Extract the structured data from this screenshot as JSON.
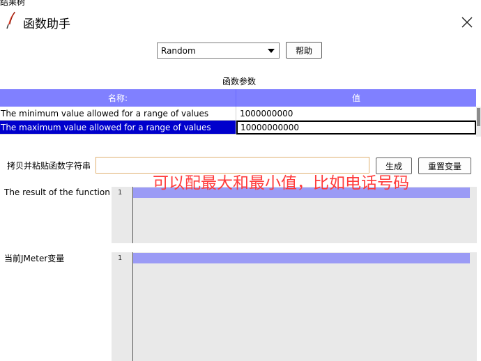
{
  "background_window": {
    "title": "结果树"
  },
  "window": {
    "title": "函数助手"
  },
  "function_select": {
    "selected": "Random"
  },
  "buttons": {
    "help": "帮助",
    "generate": "生成",
    "reset_variables": "重置变量"
  },
  "params": {
    "section_label": "函数参数",
    "columns": {
      "name": "名称:",
      "value": "值"
    },
    "rows": [
      {
        "name": "The minimum value allowed for a range of values",
        "value": "1000000000"
      },
      {
        "name": "The maximum value allowed for a range of values",
        "value": "10000000000"
      }
    ]
  },
  "copy_paste": {
    "label": "拷贝并粘贴函数字符串",
    "value": ""
  },
  "annotation": "可以配最大和最小值，比如电话号码",
  "result": {
    "label": "The result of the function is",
    "line_number": "1"
  },
  "jmeter_vars": {
    "label": "当前JMeter变量",
    "line_number": "1"
  },
  "colors": {
    "table_header": "#8080ff",
    "selected_row": "#0000cc",
    "editor_background": "#e9e9e9",
    "current_line": "#9b9bf5",
    "annotation_text": "#ff3b3b"
  },
  "icons": {
    "app": "feather-icon",
    "close": "close-icon",
    "dropdown": "chevron-down-icon"
  }
}
